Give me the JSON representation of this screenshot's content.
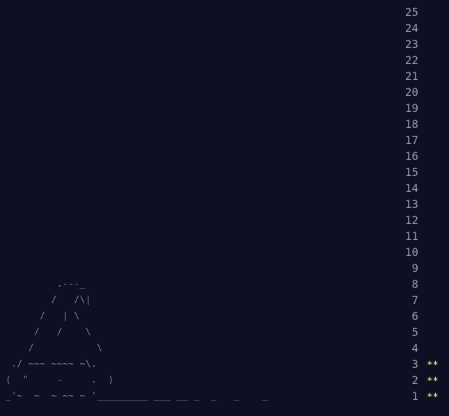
{
  "calendar": {
    "days": [
      {
        "day": "25",
        "stars": ""
      },
      {
        "day": "24",
        "stars": ""
      },
      {
        "day": "23",
        "stars": ""
      },
      {
        "day": "22",
        "stars": ""
      },
      {
        "day": "21",
        "stars": ""
      },
      {
        "day": "20",
        "stars": ""
      },
      {
        "day": "19",
        "stars": ""
      },
      {
        "day": "18",
        "stars": ""
      },
      {
        "day": "17",
        "stars": ""
      },
      {
        "day": "16",
        "stars": ""
      },
      {
        "day": "15",
        "stars": ""
      },
      {
        "day": "14",
        "stars": ""
      },
      {
        "day": "13",
        "stars": ""
      },
      {
        "day": "12",
        "stars": ""
      },
      {
        "day": "11",
        "stars": ""
      },
      {
        "day": "10",
        "stars": ""
      },
      {
        "day": "9",
        "stars": ""
      },
      {
        "day": "8",
        "stars": ""
      },
      {
        "day": "7",
        "stars": ""
      },
      {
        "day": "6",
        "stars": ""
      },
      {
        "day": "5",
        "stars": ""
      },
      {
        "day": "4",
        "stars": ""
      },
      {
        "day": "3",
        "stars": "**"
      },
      {
        "day": "2",
        "stars": "**"
      },
      {
        "day": "1",
        "stars": "**"
      }
    ],
    "art_lines": [
      "         .---_",
      "        /   /\\|",
      "      /   | \\",
      "     /   /    \\",
      "    /           \\",
      " ./ ~~~ ~~~~ ~\\.",
      "(  \"     -     .  )",
      "_'~  ~  ~ ~~ ~ '_________ ___ __ _  _   _    _"
    ]
  },
  "colors": {
    "background": "#0f0f23",
    "day_number": "#9a9aa6",
    "art": "#8a8a96",
    "star_gold": "#ffff66"
  }
}
